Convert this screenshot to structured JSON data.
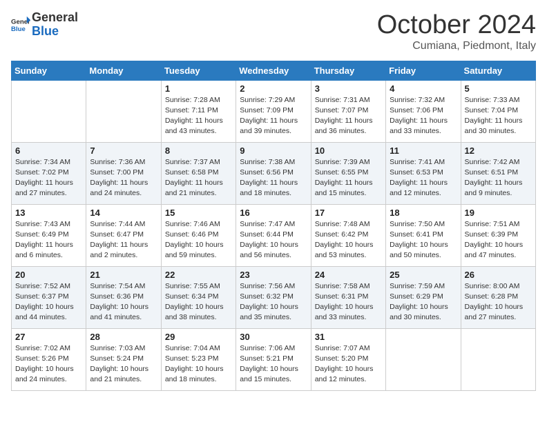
{
  "header": {
    "logo_general": "General",
    "logo_blue": "Blue",
    "month_title": "October 2024",
    "location": "Cumiana, Piedmont, Italy"
  },
  "days_of_week": [
    "Sunday",
    "Monday",
    "Tuesday",
    "Wednesday",
    "Thursday",
    "Friday",
    "Saturday"
  ],
  "weeks": [
    [
      {
        "day": "",
        "info": ""
      },
      {
        "day": "",
        "info": ""
      },
      {
        "day": "1",
        "info": "Sunrise: 7:28 AM\nSunset: 7:11 PM\nDaylight: 11 hours and 43 minutes."
      },
      {
        "day": "2",
        "info": "Sunrise: 7:29 AM\nSunset: 7:09 PM\nDaylight: 11 hours and 39 minutes."
      },
      {
        "day": "3",
        "info": "Sunrise: 7:31 AM\nSunset: 7:07 PM\nDaylight: 11 hours and 36 minutes."
      },
      {
        "day": "4",
        "info": "Sunrise: 7:32 AM\nSunset: 7:06 PM\nDaylight: 11 hours and 33 minutes."
      },
      {
        "day": "5",
        "info": "Sunrise: 7:33 AM\nSunset: 7:04 PM\nDaylight: 11 hours and 30 minutes."
      }
    ],
    [
      {
        "day": "6",
        "info": "Sunrise: 7:34 AM\nSunset: 7:02 PM\nDaylight: 11 hours and 27 minutes."
      },
      {
        "day": "7",
        "info": "Sunrise: 7:36 AM\nSunset: 7:00 PM\nDaylight: 11 hours and 24 minutes."
      },
      {
        "day": "8",
        "info": "Sunrise: 7:37 AM\nSunset: 6:58 PM\nDaylight: 11 hours and 21 minutes."
      },
      {
        "day": "9",
        "info": "Sunrise: 7:38 AM\nSunset: 6:56 PM\nDaylight: 11 hours and 18 minutes."
      },
      {
        "day": "10",
        "info": "Sunrise: 7:39 AM\nSunset: 6:55 PM\nDaylight: 11 hours and 15 minutes."
      },
      {
        "day": "11",
        "info": "Sunrise: 7:41 AM\nSunset: 6:53 PM\nDaylight: 11 hours and 12 minutes."
      },
      {
        "day": "12",
        "info": "Sunrise: 7:42 AM\nSunset: 6:51 PM\nDaylight: 11 hours and 9 minutes."
      }
    ],
    [
      {
        "day": "13",
        "info": "Sunrise: 7:43 AM\nSunset: 6:49 PM\nDaylight: 11 hours and 6 minutes."
      },
      {
        "day": "14",
        "info": "Sunrise: 7:44 AM\nSunset: 6:47 PM\nDaylight: 11 hours and 2 minutes."
      },
      {
        "day": "15",
        "info": "Sunrise: 7:46 AM\nSunset: 6:46 PM\nDaylight: 10 hours and 59 minutes."
      },
      {
        "day": "16",
        "info": "Sunrise: 7:47 AM\nSunset: 6:44 PM\nDaylight: 10 hours and 56 minutes."
      },
      {
        "day": "17",
        "info": "Sunrise: 7:48 AM\nSunset: 6:42 PM\nDaylight: 10 hours and 53 minutes."
      },
      {
        "day": "18",
        "info": "Sunrise: 7:50 AM\nSunset: 6:41 PM\nDaylight: 10 hours and 50 minutes."
      },
      {
        "day": "19",
        "info": "Sunrise: 7:51 AM\nSunset: 6:39 PM\nDaylight: 10 hours and 47 minutes."
      }
    ],
    [
      {
        "day": "20",
        "info": "Sunrise: 7:52 AM\nSunset: 6:37 PM\nDaylight: 10 hours and 44 minutes."
      },
      {
        "day": "21",
        "info": "Sunrise: 7:54 AM\nSunset: 6:36 PM\nDaylight: 10 hours and 41 minutes."
      },
      {
        "day": "22",
        "info": "Sunrise: 7:55 AM\nSunset: 6:34 PM\nDaylight: 10 hours and 38 minutes."
      },
      {
        "day": "23",
        "info": "Sunrise: 7:56 AM\nSunset: 6:32 PM\nDaylight: 10 hours and 35 minutes."
      },
      {
        "day": "24",
        "info": "Sunrise: 7:58 AM\nSunset: 6:31 PM\nDaylight: 10 hours and 33 minutes."
      },
      {
        "day": "25",
        "info": "Sunrise: 7:59 AM\nSunset: 6:29 PM\nDaylight: 10 hours and 30 minutes."
      },
      {
        "day": "26",
        "info": "Sunrise: 8:00 AM\nSunset: 6:28 PM\nDaylight: 10 hours and 27 minutes."
      }
    ],
    [
      {
        "day": "27",
        "info": "Sunrise: 7:02 AM\nSunset: 5:26 PM\nDaylight: 10 hours and 24 minutes."
      },
      {
        "day": "28",
        "info": "Sunrise: 7:03 AM\nSunset: 5:24 PM\nDaylight: 10 hours and 21 minutes."
      },
      {
        "day": "29",
        "info": "Sunrise: 7:04 AM\nSunset: 5:23 PM\nDaylight: 10 hours and 18 minutes."
      },
      {
        "day": "30",
        "info": "Sunrise: 7:06 AM\nSunset: 5:21 PM\nDaylight: 10 hours and 15 minutes."
      },
      {
        "day": "31",
        "info": "Sunrise: 7:07 AM\nSunset: 5:20 PM\nDaylight: 10 hours and 12 minutes."
      },
      {
        "day": "",
        "info": ""
      },
      {
        "day": "",
        "info": ""
      }
    ]
  ]
}
